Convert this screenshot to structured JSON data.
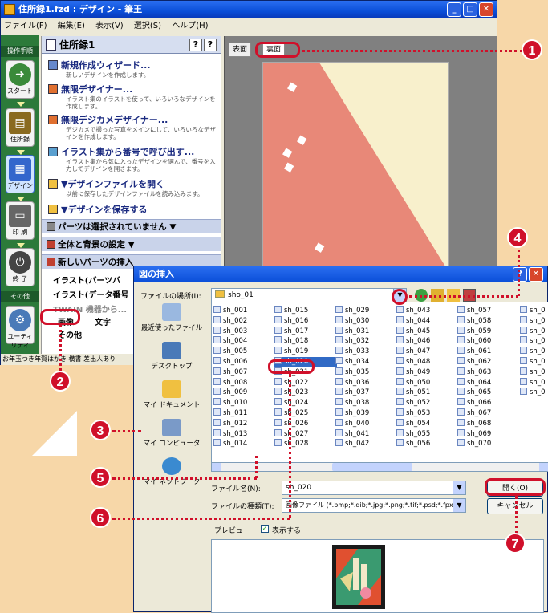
{
  "window": {
    "title": "住所録1.fzd : デザイン - 筆王",
    "menu": [
      "ファイル(F)",
      "編集(E)",
      "表示(V)",
      "選択(S)",
      "ヘルプ(H)"
    ]
  },
  "sidebar": {
    "section1": "操作手順",
    "section2": "その他",
    "buttons": [
      "スタート",
      "住所録",
      "デザイン",
      "印 刷",
      "終 了",
      "ユーティリティ"
    ]
  },
  "panel": {
    "title": "住所録1",
    "help": [
      "?",
      "?"
    ],
    "tasks": [
      {
        "label": "新規作成ウィザード...",
        "desc": "新しいデザインを作成します。"
      },
      {
        "label": "無限デザイナー...",
        "desc": "イラスト集のイラストを使って、いろいろなデザインを作成します。"
      },
      {
        "label": "無限デジカメデザイナー...",
        "desc": "デジカメで撮った写真をメインにして、いろいろなデザインを作成します。"
      },
      {
        "label": "イラスト集から番号で呼び出す...",
        "desc": "イラスト集から気に入ったデザインを選んで、番号を入力してデザインを開きます。"
      },
      {
        "label": "▼デザインファイルを開く",
        "desc": "以前に保存したデザインファイルを読み込みます。"
      },
      {
        "label": "▼デザインを保存する",
        "desc": ""
      }
    ],
    "sections": [
      "パーツは選択されていません ▼",
      "全体と背景の設定 ▼",
      "新しいパーツの挿入"
    ],
    "insert_items": [
      "イラスト(パーツバ",
      "イラスト(データ番号",
      "TWAIN 機器から...",
      "画像",
      "文字",
      "その他"
    ],
    "statusbar": "お年玉つき年賀はがき 横書 差出人あり"
  },
  "canvas": {
    "tabs": [
      "表面",
      "裏面"
    ]
  },
  "dialog": {
    "title": "図の挿入",
    "lookin_label": "ファイルの場所(I):",
    "lookin_value": "sho_01",
    "places": [
      "最近使ったファイル",
      "デスクトップ",
      "マイ ドキュメント",
      "マイ コンピュータ",
      "マイ ネットワーク"
    ],
    "columns": [
      [
        "sh_001",
        "sh_002",
        "sh_003",
        "sh_004",
        "sh_005",
        "sh_006",
        "sh_007",
        "sh_008",
        "sh_009",
        "sh_010",
        "sh_011",
        "sh_012",
        "sh_013",
        "sh_014"
      ],
      [
        "sh_015",
        "sh_016",
        "sh_017",
        "sh_018",
        "sh_019",
        "sh_020",
        "sh_021",
        "sh_022",
        "sh_023",
        "sh_024",
        "sh_025",
        "sh_026",
        "sh_027",
        "sh_028"
      ],
      [
        "sh_029",
        "sh_030",
        "sh_031",
        "sh_032",
        "sh_033",
        "sh_034",
        "sh_035",
        "sh_036",
        "sh_037",
        "sh_038",
        "sh_039",
        "sh_040",
        "sh_041",
        "sh_042"
      ],
      [
        "sh_043",
        "sh_044",
        "sh_045",
        "sh_046",
        "sh_047",
        "sh_048",
        "sh_049",
        "sh_050",
        "sh_051",
        "sh_052",
        "sh_053",
        "sh_054",
        "sh_055",
        "sh_056"
      ],
      [
        "sh_057",
        "sh_058",
        "sh_059",
        "sh_060",
        "sh_061",
        "sh_062",
        "sh_063",
        "sh_064",
        "sh_065",
        "sh_066",
        "sh_067",
        "sh_068",
        "sh_069",
        "sh_070"
      ],
      [
        "sh_0",
        "sh_0",
        "sh_0",
        "sh_0",
        "sh_0",
        "sh_0",
        "sh_0",
        "sh_0",
        "sh_0"
      ]
    ],
    "selected_file": "sh_020",
    "filename_label": "ファイル名(N):",
    "filename_value": "sh_020",
    "filetype_label": "ファイルの種類(T):",
    "filetype_value": "画像ファイル (*.bmp;*.dib;*.jpg;*.png;*.tif;*.psd;*.fpx)",
    "open_button": "開く(O)",
    "cancel_button": "キャンセル",
    "preview_label": "プレビュー",
    "show_label": "表示する"
  },
  "callouts": [
    "1",
    "2",
    "3",
    "4",
    "5",
    "6",
    "7"
  ],
  "colors": {
    "accent": "#d0102a",
    "titlebar": "#0a4ed8",
    "background": "#f7d7a8"
  }
}
